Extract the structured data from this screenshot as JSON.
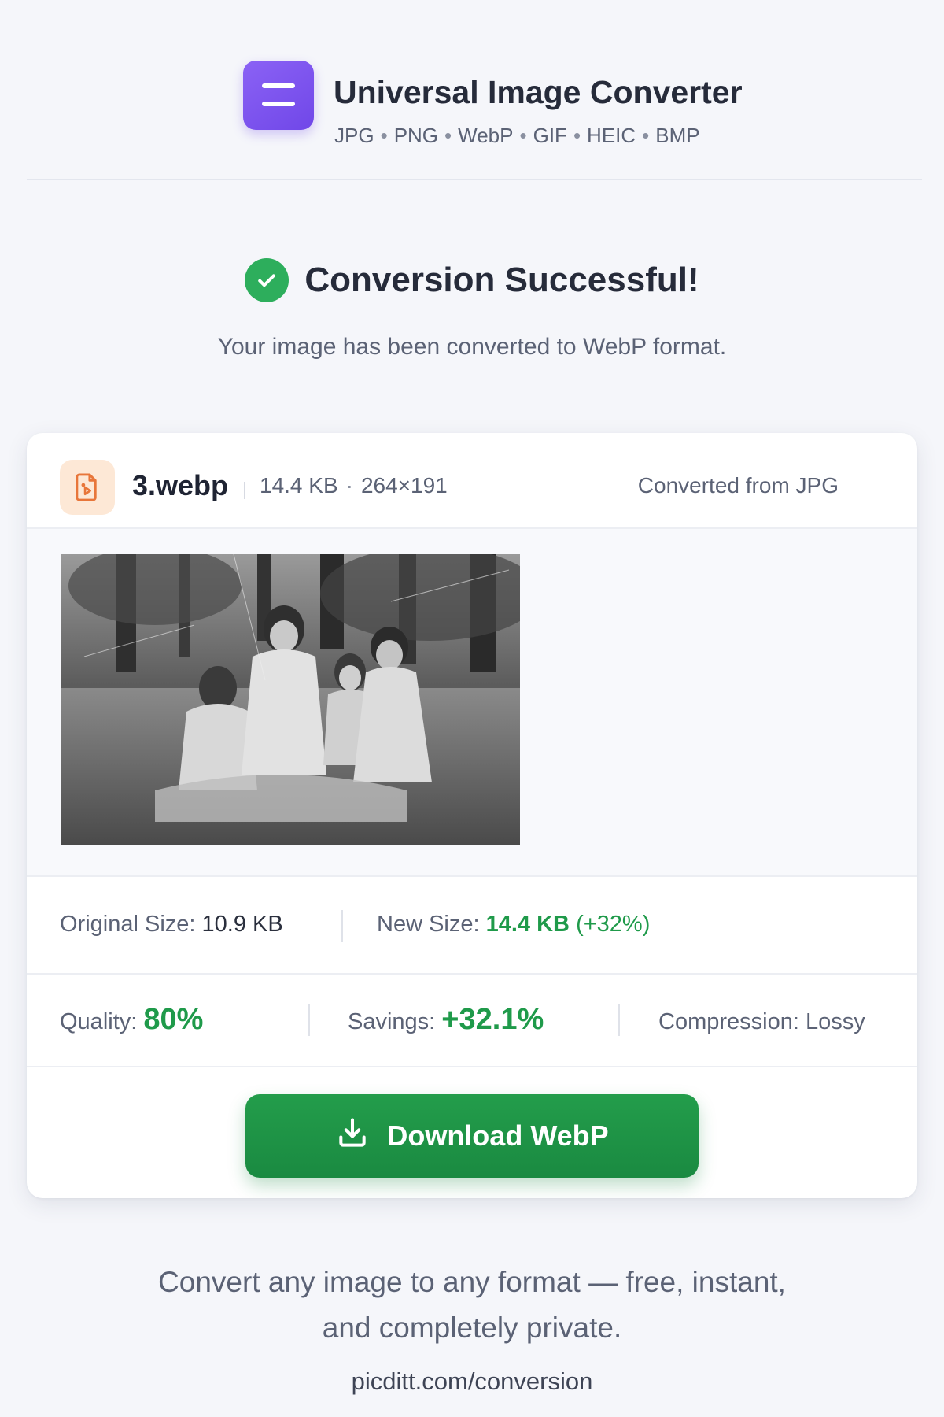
{
  "header": {
    "title": "Universal Image Converter",
    "formats": [
      "JPG",
      "PNG",
      "WebP",
      "GIF",
      "HEIC",
      "BMP"
    ],
    "format_separator": "•"
  },
  "status": {
    "title": "Conversion Successful!",
    "subtitle": "Your image has been converted to WebP format."
  },
  "file": {
    "name": "3.webp",
    "size": "14.4 KB",
    "dimensions": "264×191",
    "meta_separator": "·",
    "source": "Converted from JPG"
  },
  "sizes": {
    "original_label": "Original Size:",
    "original_value": "10.9 KB",
    "new_label": "New Size:",
    "new_value": "14.4 KB",
    "new_change": "(+32%)"
  },
  "metrics": {
    "quality_label": "Quality:",
    "quality_value": "80%",
    "savings_label": "Savings:",
    "savings_value": "+32.1%",
    "compression_label": "Compression:",
    "compression_value": "Lossy"
  },
  "actions": {
    "download_label": "Download WebP"
  },
  "footer": {
    "tagline": "Convert any image to any format — free, instant, and completely private.",
    "link": "picditt.com/conversion"
  },
  "colors": {
    "accent_purple": "#7a52ee",
    "success_green": "#2dae5c",
    "value_green": "#1f9a4a",
    "file_icon_bg": "#fde8d6",
    "file_icon_fg": "#e8763a"
  },
  "icons": {
    "logo": "menu-lines-icon",
    "status": "check-circle-icon",
    "file": "image-file-icon",
    "download": "download-icon"
  }
}
